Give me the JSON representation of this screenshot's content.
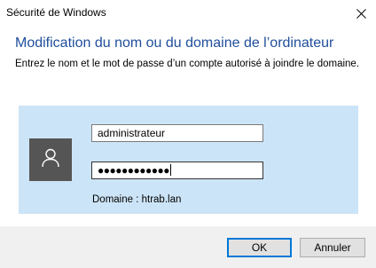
{
  "window": {
    "title": "Sécurité de Windows"
  },
  "dialog": {
    "heading": "Modification du nom ou du domaine de l’ordinateur",
    "description": "Entrez le nom et le mot de passe d’un compte autorisé à joindre le domaine."
  },
  "credentials": {
    "avatar_icon": "user-icon",
    "username_value": "administrateur",
    "password_mask": "●●●●●●●●●●●●",
    "domain_label": "Domaine : htrab.lan"
  },
  "buttons": {
    "ok_label": "OK",
    "cancel_label": "Annuler"
  },
  "colors": {
    "heading": "#1f4e9c",
    "panel": "#cce4f7",
    "avatar": "#555555",
    "default_button_border": "#0078d7"
  }
}
